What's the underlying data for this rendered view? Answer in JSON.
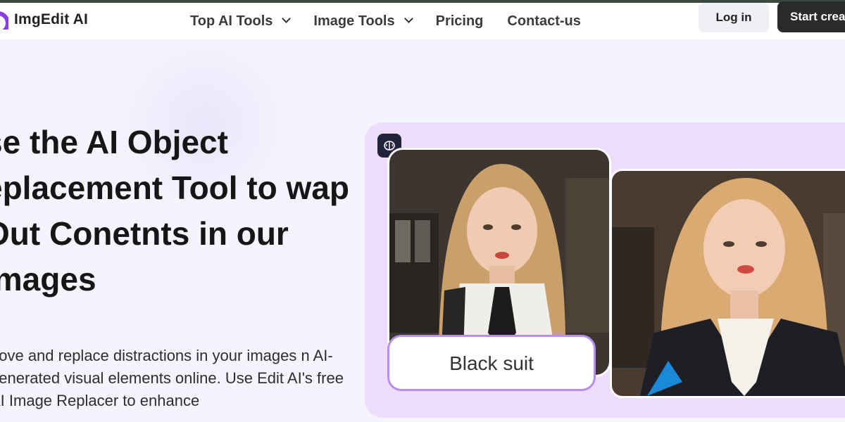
{
  "app": {
    "name": "ImgEdit AI"
  },
  "nav": {
    "items": [
      {
        "label": "Top AI Tools",
        "has_dropdown": true
      },
      {
        "label": "Image Tools",
        "has_dropdown": true
      },
      {
        "label": "Pricing",
        "has_dropdown": false
      },
      {
        "label": "Contact-us",
        "has_dropdown": false
      }
    ]
  },
  "header": {
    "login_label": "Log in",
    "start_label": "Start creat"
  },
  "hero": {
    "headline": "se the AI Object eplacement Tool to wap Out Conetnts in our Images",
    "description": "nove and replace distractions in your images n AI-generated visual elements online. Use Edit AI's free AI Image Replacer to enhance"
  },
  "demo": {
    "tag_label": "Black suit",
    "icons": {
      "badge": "brain-icon"
    }
  },
  "colors": {
    "accent": "#8a3fe0",
    "panel": "#eedcff",
    "dark_button": "#2b2b2b"
  }
}
